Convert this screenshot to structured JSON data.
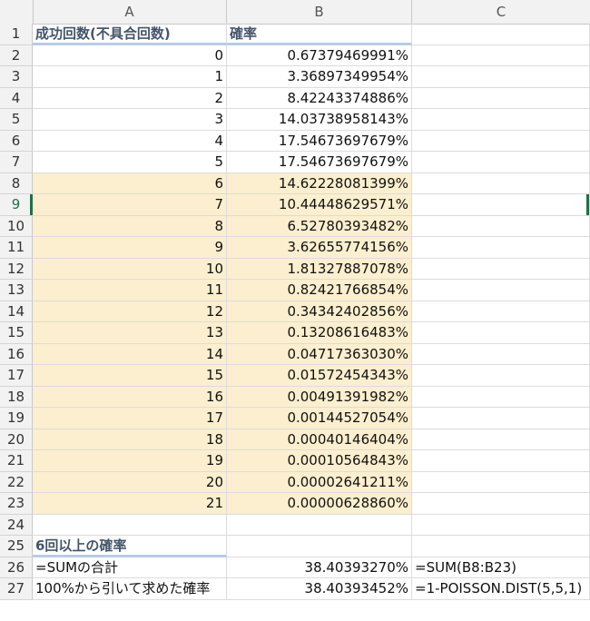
{
  "columns": [
    "A",
    "B",
    "C"
  ],
  "header": {
    "row": "1",
    "a": "成功回数(不具合回数)",
    "b": "確率"
  },
  "rows": [
    {
      "r": "2",
      "a": "0",
      "b": "0.67379469991%"
    },
    {
      "r": "3",
      "a": "1",
      "b": "3.36897349954%"
    },
    {
      "r": "4",
      "a": "2",
      "b": "8.42243374886%"
    },
    {
      "r": "5",
      "a": "3",
      "b": "14.03738958143%"
    },
    {
      "r": "6",
      "a": "4",
      "b": "17.54673697679%"
    },
    {
      "r": "7",
      "a": "5",
      "b": "17.54673697679%"
    },
    {
      "r": "8",
      "a": "6",
      "b": "14.62228081399%"
    },
    {
      "r": "9",
      "a": "7",
      "b": "10.44448629571%"
    },
    {
      "r": "10",
      "a": "8",
      "b": "6.52780393482%"
    },
    {
      "r": "11",
      "a": "9",
      "b": "3.62655774156%"
    },
    {
      "r": "12",
      "a": "10",
      "b": "1.81327887078%"
    },
    {
      "r": "13",
      "a": "11",
      "b": "0.82421766854%"
    },
    {
      "r": "14",
      "a": "12",
      "b": "0.34342402856%"
    },
    {
      "r": "15",
      "a": "13",
      "b": "0.13208616483%"
    },
    {
      "r": "16",
      "a": "14",
      "b": "0.04717363030%"
    },
    {
      "r": "17",
      "a": "15",
      "b": "0.01572454343%"
    },
    {
      "r": "18",
      "a": "16",
      "b": "0.00491391982%"
    },
    {
      "r": "19",
      "a": "17",
      "b": "0.00144527054%"
    },
    {
      "r": "20",
      "a": "18",
      "b": "0.00040146404%"
    },
    {
      "r": "21",
      "a": "19",
      "b": "0.00010564843%"
    },
    {
      "r": "22",
      "a": "20",
      "b": "0.00002641211%"
    },
    {
      "r": "23",
      "a": "21",
      "b": "0.00000628860%"
    }
  ],
  "row24": "24",
  "section": {
    "row": "25",
    "title": "6回以上の確率"
  },
  "sum_row": {
    "row": "26",
    "a": "=SUMの合計",
    "b": "38.40393270%",
    "c": "=SUM(B8:B23)"
  },
  "poisson_row": {
    "row": "27",
    "a": "100%から引いて求めた確率",
    "b": "38.40393452%",
    "c": "=1-POISSON.DIST(5,5,1)"
  },
  "active_row": "9",
  "colors": {
    "highlight": "#fcefcf",
    "header_text": "#44546a",
    "header_underline": "#b8cce4",
    "selection": "#1e7145"
  }
}
